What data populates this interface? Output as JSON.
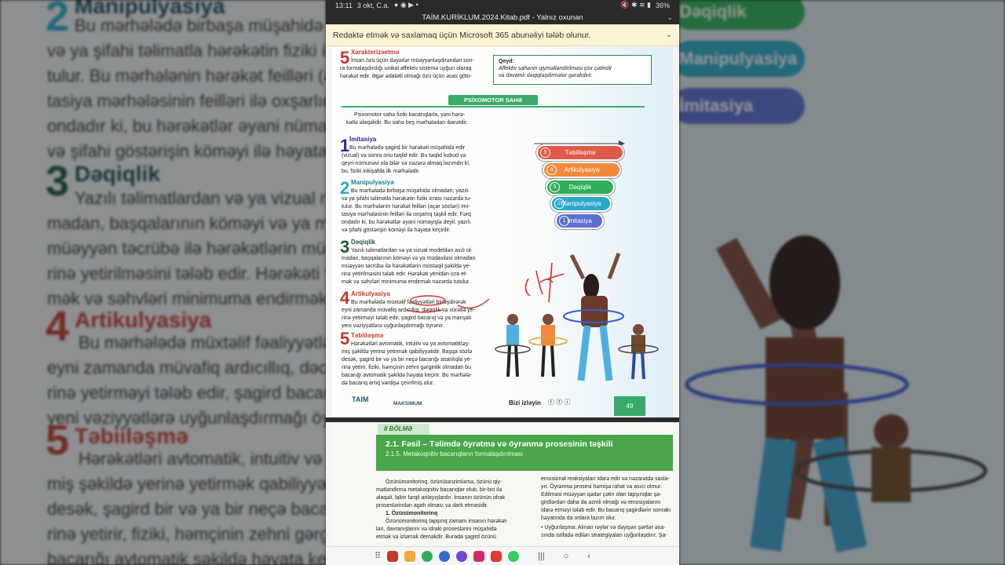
{
  "status_bar": {
    "time": "13:11",
    "date": "3 okt, C.a.",
    "battery": "36%"
  },
  "pdf_title": "TAİM.KURİKLUM.2024.Kitab.pdf - Yalnız oxunan",
  "notice_banner": {
    "text": "Redaktə etmək və saxlamaq üçün Microsoft 365 abunəliyi tələb olunur."
  },
  "colors": {
    "banner_bg": "#fbf3d3",
    "brand_green": "#3aaa6a"
  },
  "page_top": {
    "section5_title": "Xarakterizəetmə",
    "section5_text": [
      "İnsan özü üçün dəyərlər müəyyənləşdirəndən son-",
      "ra formalaşdırdığı unikal affektiv sistemə uyğun olaraq",
      "hərəkət edir. Əgər ədalətli olmağı özü üçün əsas götü-"
    ],
    "note_title": "Qeyd:",
    "note_text": [
      "Affektiv sahənin qiymətləndirilməsi çox çətindir",
      "və davamlı dəqiqləşdirmələr gərəkdirir."
    ],
    "domain_title": "PSİXOMOTOR SAHƏ",
    "intro": [
      "Psixomotor sahə fiziki bacarıqlarla, yəni hərə-",
      "kətlə əlaqəlidir. Bu sahə beş mərhələdən ibarətdir."
    ],
    "stages": [
      {
        "num": "1",
        "title": "İmitasiya",
        "lines": [
          "Bu mərhələdə şagird bir hərəkəti müşahidə edir",
          "(vizual) və sonra onu təqlid edir. Bu təqlid kobud və",
          "qeyri-nümunəvi ola bilər və nəzərə almaq lazımdır ki,",
          "bu, fiziki inkişafda ilk mərhələdir."
        ]
      },
      {
        "num": "2",
        "title": "Manipulyasiya",
        "lines": [
          "Bu mərhələdə birbaşa müşahidə olmadan, yazılı",
          "və ya şifahi təlimatla hərəkətin fiziki icrası nəzərdə tu-",
          "tulur. Bu mərhələnin hərəkət feilləri (açar sözləri) imi-",
          "tasiya mərhələsinin feilləri ilə oxşarlıq təşkil edir. Fərq",
          "ondadır ki, bu hərəkətlər əyani nümayişlə deyil, yazılı",
          "və şifahi göstərişin köməyi ilə həyata keçirilir."
        ]
      },
      {
        "num": "3",
        "title": "Dəqiqlik",
        "lines": [
          "Yazılı təlimatlardan və ya vizual modeldən asılı ol-",
          "madan, başqalarının köməyi və ya müdaxiləsi olmadan",
          "müəyyən təcrübə ilə hərəkətlərin müstəqil şəkildə ye-",
          "rinə yetirilməsini tələb edir. Hərəkəti yenidən icra et-",
          "mək və səhvləri minimuma endirmək nəzərdə tutulur."
        ]
      },
      {
        "num": "4",
        "title": "Artikulyasiya",
        "lines": [
          "Bu mərhələdə müxtəlif fəaliyyətləri birləşdirərək",
          "eyni zamanda müvafiq ardıcıllıq, dəqiqlik və sürətlə ye-",
          "rinə yetirməyi tələb edir, şagird bacarıq və ya manşalı",
          "yeni vəziyyətlərə uyğunlaşdırmağı öyrənir."
        ]
      },
      {
        "num": "5",
        "title": "Təbiiləşmə",
        "lines": [
          "Hərəkətləri avtomatik, intuitiv və ya avtomatikləş-",
          "miş şəkildə yerinə yetirmək qabiliyyətidir. Başqa sözlə",
          "desək, şagird bir və ya bir neçə bacarığı asanlıqla ye-",
          "rinə yetirir, fiziki, həmçinin zehni gərginlik olmadan bu",
          "bacarığı avtomatik şəkildə həyata keçirir. Bu mərhələ-",
          "də bacarıq artıq vərdişə çevrilmiş olur."
        ]
      }
    ],
    "levels": [
      {
        "num": "5",
        "label": "Təbiiləşmə",
        "color": "#e05a4a"
      },
      {
        "num": "4",
        "label": "Artikulyasiya",
        "color": "#f08a3a"
      },
      {
        "num": "3",
        "label": "Dəqiqlik",
        "color": "#2fae5a"
      },
      {
        "num": "2",
        "label": "Manipulyasiya",
        "color": "#29a9c9"
      },
      {
        "num": "1",
        "label": "İmitasiya",
        "color": "#5a6fd0"
      }
    ],
    "logo_left": "TAIM",
    "logo_right": "MAKSIMUM",
    "follow": "Bizi izləyin",
    "page_number": "49"
  },
  "page_bottom": {
    "section_label": "II BÖLMƏ",
    "chapter_title": "2.1. Fəsil – Təlimdə öyrətmə və öyrənmə prosesinin təşkili",
    "chapter_subtitle": "2.1.5. Metakoqnitiv bacarıqların formalaşdırılması",
    "col1": [
      "Özünümonitorinq, özünütənzimləmə, özünü qiy-",
      "mətləndirmə metakoqnitiv bacarıqlar olub, bir-biri ilə",
      "əlaqəli, lakin fərqli anlayışlardır. İnsanın özünün idrak",
      "proseslərindən agah olması və dark etmasidir."
    ],
    "col1_heading": "1. Özünümonitorinq",
    "col1_b": [
      "Özünümonitorinq tapşırıq zamanı insanın hərəkət-",
      "ləri, davranışlarını və idraki proseslərini müşahidə",
      "etmək və izləmək deməkdir. Burada şagird özünü"
    ],
    "col2": [
      "emosional reaksiyaları idarə edir və nəzarətdə saxla-",
      "yır. Öyrənmə prosesi həmişə rahat və asıcı olmur.",
      "Edilməsi müəyyən qədər çətin olan tapşırıqlar şa-",
      "girdlərdən daha da əzmli olmağı və emosiyalarını",
      "idarə etməyi tələb edir. Bu bacarıq şagirdlərin sonrakı",
      "həyatında da onlara lazım olur."
    ],
    "col2_b": [
      "• Uyğunlaşma: Alınan rəylər və dəyişən şərtlər əsa-",
      "sında istifadə edilən strategiyaları uyğunlaşdırır. Şa-"
    ]
  }
}
